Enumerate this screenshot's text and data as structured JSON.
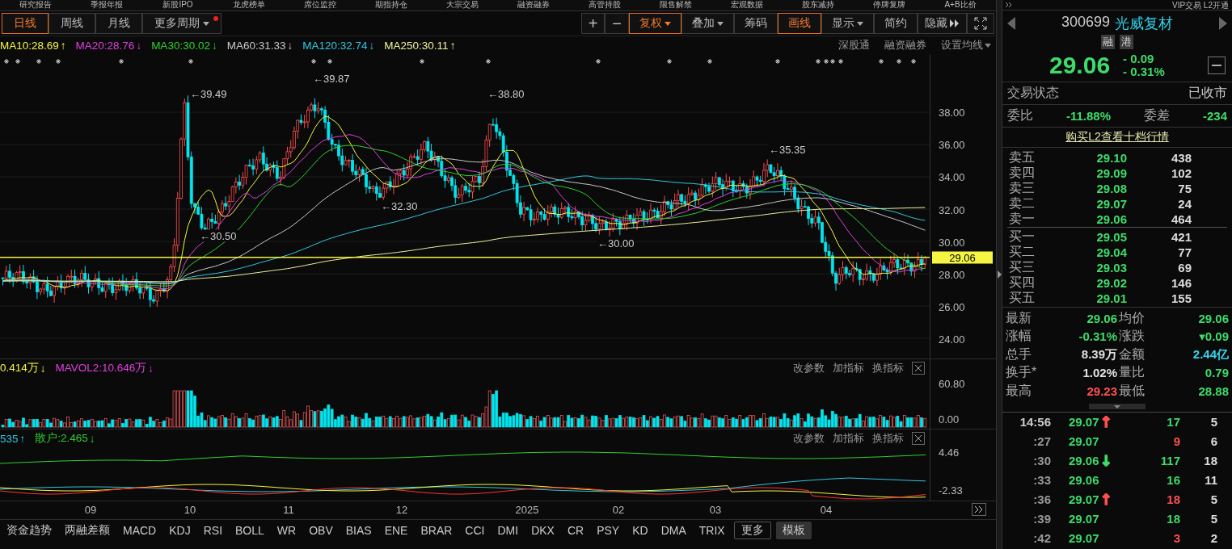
{
  "top_nav": [
    "研究报告",
    "季报年报",
    "新股IPO",
    "龙虎榜单",
    "席位监控",
    "期指持仓",
    "大宗交易",
    "融资融券",
    "高管持股",
    "限售解禁",
    "宏观数据",
    "股东减持",
    "停牌复牌",
    "A+B比价"
  ],
  "period_tabs": [
    {
      "label": "日线",
      "selected": true
    },
    {
      "label": "周线",
      "selected": false
    },
    {
      "label": "月线",
      "selected": false
    },
    {
      "label": "更多周期",
      "selected": false,
      "dropdown": true,
      "notification": true
    }
  ],
  "toolbar": [
    {
      "kind": "plus",
      "label": "+",
      "selected": false
    },
    {
      "kind": "minus",
      "label": "−",
      "selected": false
    },
    {
      "kind": "text",
      "label": "复权",
      "dropdown": true,
      "selected": true
    },
    {
      "kind": "text",
      "label": "叠加",
      "dropdown": true,
      "selected": false
    },
    {
      "kind": "text",
      "label": "筹码",
      "selected": false
    },
    {
      "kind": "text",
      "label": "画线",
      "selected": true
    },
    {
      "kind": "text",
      "label": "显示",
      "dropdown": true,
      "selected": false
    },
    {
      "kind": "text",
      "label": "简约",
      "selected": false
    },
    {
      "kind": "hide",
      "label": "隐藏",
      "selected": false
    },
    {
      "kind": "fullscreen",
      "selected": false
    }
  ],
  "ma_legend": [
    {
      "label": "MA10:28.69",
      "arrow": "↑",
      "color": "#f5f542"
    },
    {
      "label": "MA20:28.76",
      "arrow": "↓",
      "color": "#e040e0"
    },
    {
      "label": "MA30:30.02",
      "arrow": "↓",
      "color": "#30d030"
    },
    {
      "label": "MA60:31.33",
      "arrow": "↓",
      "color": "#c8c8c8"
    },
    {
      "label": "MA120:32.74",
      "arrow": "↓",
      "color": "#30c8e0"
    },
    {
      "label": "MA250:30.11",
      "arrow": "↑",
      "color": "#f0f0a0"
    }
  ],
  "chart_links": [
    {
      "label": "深股通"
    },
    {
      "label": "融资融券"
    },
    {
      "label": "设置均线",
      "dropdown": true
    }
  ],
  "price_axis": [
    "38.00",
    "36.00",
    "34.00",
    "32.00",
    "30.00",
    "28.00",
    "26.00",
    "24.00"
  ],
  "current_price_tag": "29.06",
  "annotations": [
    "←39.49",
    "←39.87",
    "←38.80",
    "←32.30",
    "←30.50",
    "←30.00",
    "←35.35"
  ],
  "volume_pane": {
    "legend": [
      {
        "label": "0.414万",
        "arrow": "↓",
        "color": "#f5f542"
      },
      {
        "label": "MAVOL2:10.646万",
        "arrow": "↓",
        "color": "#e040e0"
      }
    ],
    "actions": [
      "改参数",
      "加指标",
      "换指标"
    ],
    "ticks": [
      "60.80",
      "0.00"
    ]
  },
  "indicator_pane": {
    "legend": [
      {
        "label": "535",
        "arrow": "↑",
        "color": "#30c8e0"
      },
      {
        "label": "散户:2.465",
        "arrow": "↓",
        "color": "#30d030"
      }
    ],
    "actions": [
      "改参数",
      "加指标",
      "换指标"
    ],
    "ticks": [
      "4.46",
      "-2.33"
    ]
  },
  "x_axis": [
    "09",
    "10",
    "11",
    "12",
    "2025",
    "02",
    "03",
    "04"
  ],
  "bottom_tabs": [
    {
      "label": "资金趋势",
      "kind": "tab"
    },
    {
      "label": "两融差额",
      "kind": "tab"
    },
    {
      "label": "MACD",
      "kind": "tab"
    },
    {
      "label": "KDJ",
      "kind": "tab"
    },
    {
      "label": "RSI",
      "kind": "tab"
    },
    {
      "label": "BOLL",
      "kind": "tab"
    },
    {
      "label": "WR",
      "kind": "tab"
    },
    {
      "label": "OBV",
      "kind": "tab"
    },
    {
      "label": "BIAS",
      "kind": "tab"
    },
    {
      "label": "ENE",
      "kind": "tab"
    },
    {
      "label": "BRAR",
      "kind": "tab"
    },
    {
      "label": "CCI",
      "kind": "tab"
    },
    {
      "label": "DMI",
      "kind": "tab"
    },
    {
      "label": "DKX",
      "kind": "tab"
    },
    {
      "label": "CR",
      "kind": "tab"
    },
    {
      "label": "PSY",
      "kind": "tab"
    },
    {
      "label": "KD",
      "kind": "tab"
    },
    {
      "label": "DMA",
      "kind": "tab"
    },
    {
      "label": "TRIX",
      "kind": "tab"
    },
    {
      "label": "更多",
      "kind": "more"
    },
    {
      "label": "模板",
      "kind": "template"
    }
  ],
  "quote": {
    "header": "VIP交易  L2开通",
    "code": "300699",
    "name": "光威复材",
    "badges": [
      "融",
      "港"
    ],
    "price": "29.06",
    "change": "- 0.09",
    "change_pct": "- 0.31%",
    "status_label": "交易状态",
    "status_value": "已收市",
    "ratio": [
      {
        "label": "委比",
        "value": "-11.88%"
      },
      {
        "label": "委差",
        "value": "-234"
      }
    ],
    "l2_link": "购买L2查看十档行情",
    "asks": [
      {
        "label": "卖五",
        "price": "29.10",
        "volume": "438"
      },
      {
        "label": "卖四",
        "price": "29.09",
        "volume": "102"
      },
      {
        "label": "卖三",
        "price": "29.08",
        "volume": "75"
      },
      {
        "label": "卖二",
        "price": "29.07",
        "volume": "24"
      },
      {
        "label": "卖一",
        "price": "29.06",
        "volume": "464"
      }
    ],
    "bids": [
      {
        "label": "买一",
        "price": "29.05",
        "volume": "421"
      },
      {
        "label": "买二",
        "price": "29.04",
        "volume": "77"
      },
      {
        "label": "买三",
        "price": "29.03",
        "volume": "69"
      },
      {
        "label": "买四",
        "price": "29.02",
        "volume": "146"
      },
      {
        "label": "买五",
        "price": "29.01",
        "volume": "155"
      }
    ],
    "stats": [
      {
        "label": "最新",
        "value": "29.06",
        "color": "#3ddc6a"
      },
      {
        "label": "均价",
        "value": "29.06",
        "color": "#3ddc6a"
      },
      {
        "label": "涨幅",
        "value": "-0.31%",
        "color": "#3ddc6a"
      },
      {
        "label": "涨跌",
        "value": "▾0.09",
        "color": "#3ddc6a"
      },
      {
        "label": "总手",
        "value": "8.39万",
        "color": "#e0e0e0"
      },
      {
        "label": "金额",
        "value": "2.44亿",
        "color": "#30d8f0"
      },
      {
        "label": "换手*",
        "value": "1.02%",
        "color": "#e0e0e0"
      },
      {
        "label": "量比",
        "value": "0.79",
        "color": "#3ddc6a"
      },
      {
        "label": "最高",
        "value": "29.23",
        "color": "#ff5050"
      },
      {
        "label": "最低",
        "value": "28.88",
        "color": "#3ddc6a"
      }
    ],
    "ticks": [
      {
        "time": "14:56",
        "price": "29.07",
        "arrow": {
          "glyph": "↑",
          "color": "#ff5050"
        },
        "volume": "17",
        "color": "#3ddc6a",
        "count": "5"
      },
      {
        "time": ":27",
        "price": "29.07",
        "volume": "9",
        "color": "#ff5050",
        "count": "6"
      },
      {
        "time": ":30",
        "price": "29.06",
        "arrow": {
          "glyph": "↓",
          "color": "#3ddc6a"
        },
        "volume": "117",
        "color": "#3ddc6a",
        "count": "18"
      },
      {
        "time": ":33",
        "price": "29.06",
        "volume": "16",
        "color": "#3ddc6a",
        "count": "11"
      },
      {
        "time": ":36",
        "price": "29.07",
        "arrow": {
          "glyph": "↑",
          "color": "#ff5050"
        },
        "volume": "18",
        "color": "#ff5050",
        "count": "5"
      },
      {
        "time": ":39",
        "price": "29.07",
        "volume": "18",
        "color": "#3ddc6a",
        "count": "5"
      },
      {
        "time": ":42",
        "price": "29.07",
        "volume": "3",
        "color": "#ff5050",
        "count": "2"
      }
    ]
  }
}
